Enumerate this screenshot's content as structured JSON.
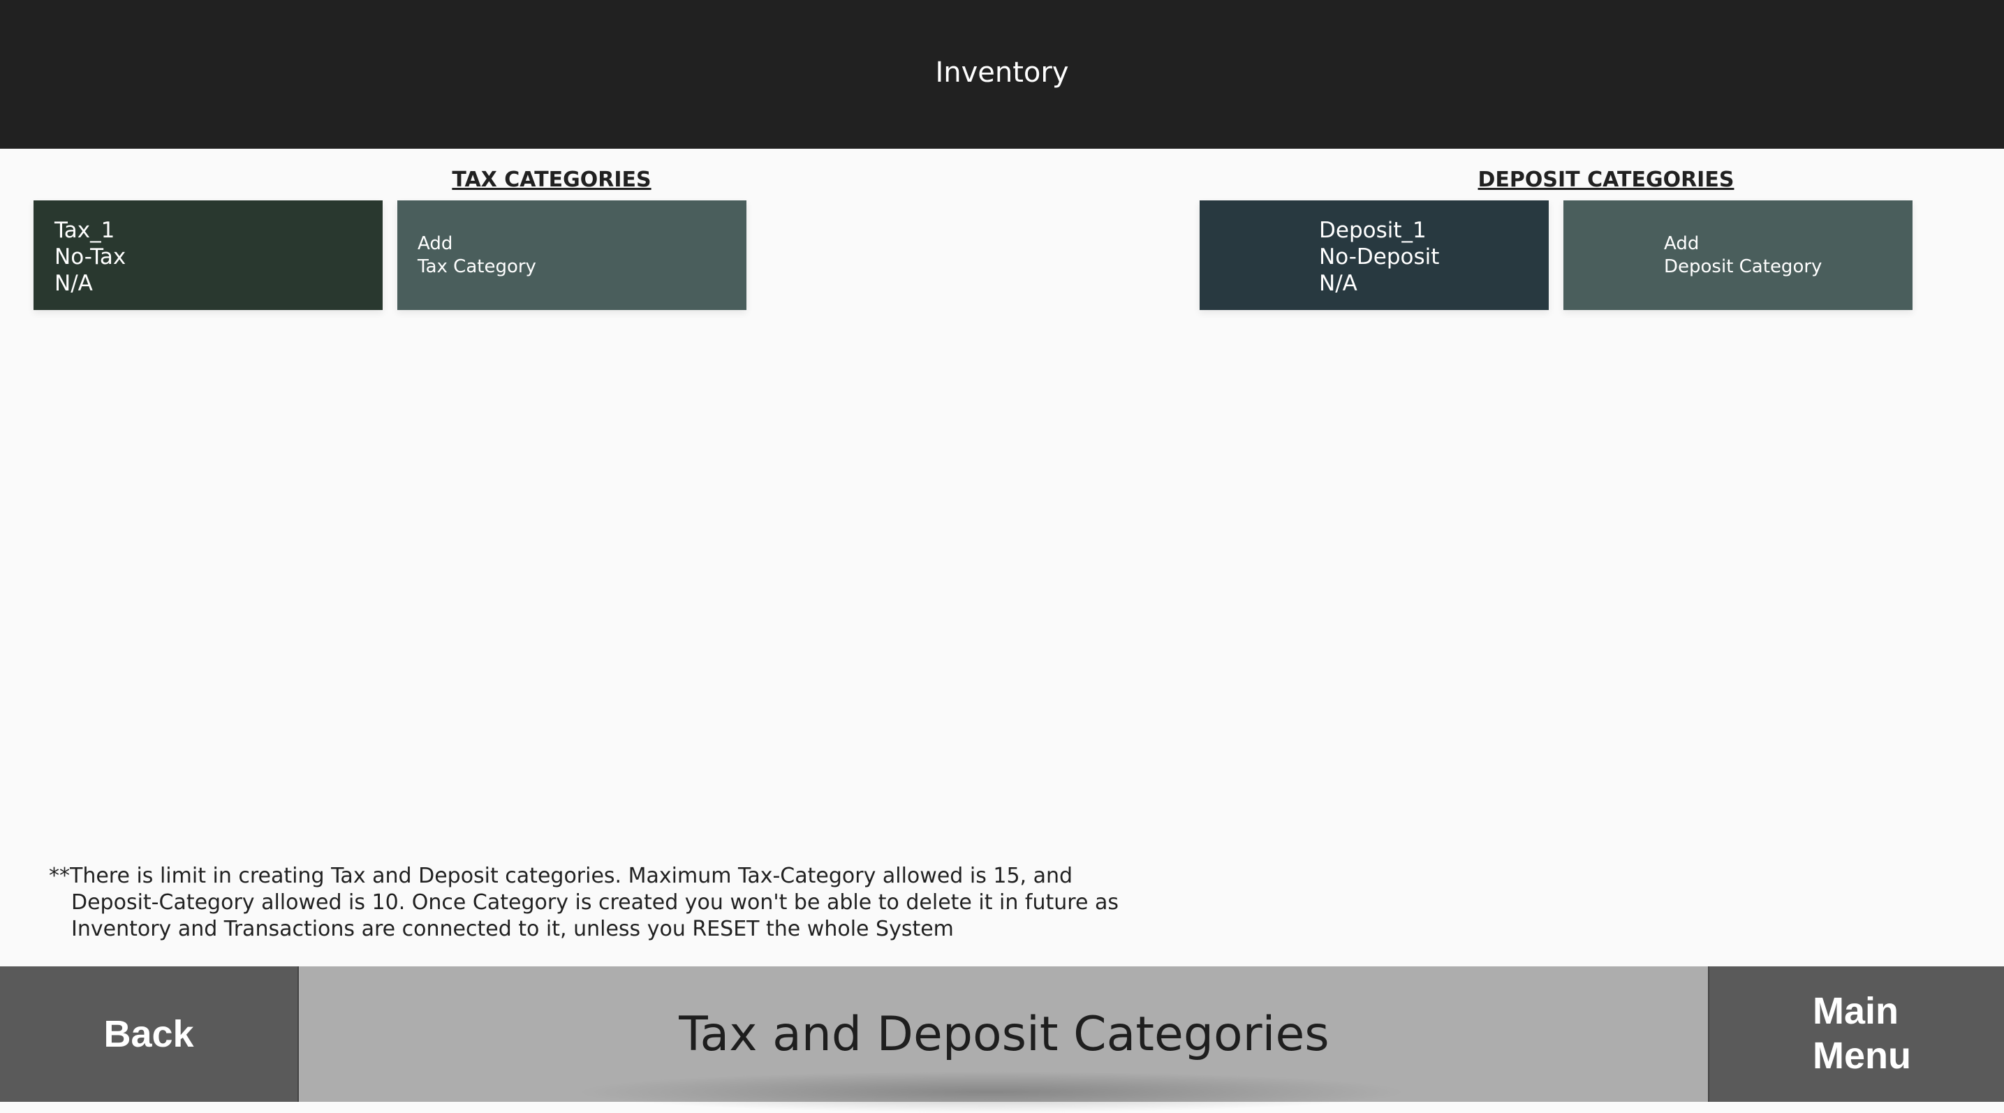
{
  "header": {
    "title": "Inventory"
  },
  "tax": {
    "section_title": "TAX CATEGORIES",
    "items": [
      {
        "lines": [
          "Tax_1",
          "No-Tax",
          "N/A"
        ]
      }
    ],
    "add_button": {
      "line1": "Add",
      "line2": "Tax Category"
    },
    "color": "#29382f"
  },
  "deposit": {
    "section_title": "DEPOSIT CATEGORIES",
    "items": [
      {
        "lines": [
          "Deposit_1",
          "No-Deposit",
          "N/A"
        ]
      }
    ],
    "add_button": {
      "line1": "Add",
      "line2": "Deposit Category"
    },
    "color": "#283940"
  },
  "note": {
    "line1": "**There is limit in creating Tax and Deposit categories. Maximum Tax-Category allowed is 15, and",
    "line2": "Deposit-Category allowed is 10. Once Category is created you won't be able to delete it in future as",
    "line3": "Inventory and Transactions are connected to it, unless you RESET the whole System"
  },
  "footer": {
    "back_label": "Back",
    "page_title": "Tax and Deposit Categories",
    "main_menu_line1": "Main",
    "main_menu_line2": "Menu"
  },
  "colors": {
    "header_bg": "#212121",
    "add_tile": "#4a5e5c",
    "footer_bg": "#adadad",
    "footer_button": "#5a5a5a"
  }
}
